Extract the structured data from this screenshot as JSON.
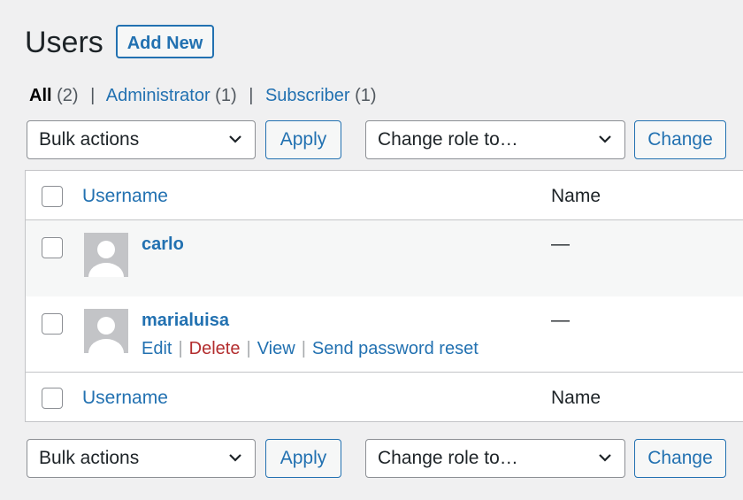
{
  "header": {
    "title": "Users",
    "add_new_label": "Add New"
  },
  "filters": [
    {
      "label": "All",
      "count": "(2)",
      "current": true
    },
    {
      "label": "Administrator",
      "count": "(1)",
      "current": false
    },
    {
      "label": "Subscriber",
      "count": "(1)",
      "current": false
    }
  ],
  "filter_separator": "|",
  "top_controls": {
    "bulk_actions": "Bulk actions",
    "apply": "Apply",
    "change_role": "Change role to…",
    "change": "Change"
  },
  "bottom_controls": {
    "bulk_actions": "Bulk actions",
    "apply": "Apply",
    "change_role": "Change role to…",
    "change": "Change"
  },
  "table": {
    "columns": {
      "username": "Username",
      "name": "Name"
    },
    "rows": [
      {
        "username": "carlo",
        "name": "—",
        "actions": []
      },
      {
        "username": "marialuisa",
        "name": "—",
        "actions": [
          "Edit",
          "Delete",
          "View",
          "Send password reset"
        ]
      }
    ],
    "action_separator": "|"
  },
  "colors": {
    "link": "#2271b1",
    "delete": "#b32d2e",
    "background": "#f0f0f1"
  }
}
